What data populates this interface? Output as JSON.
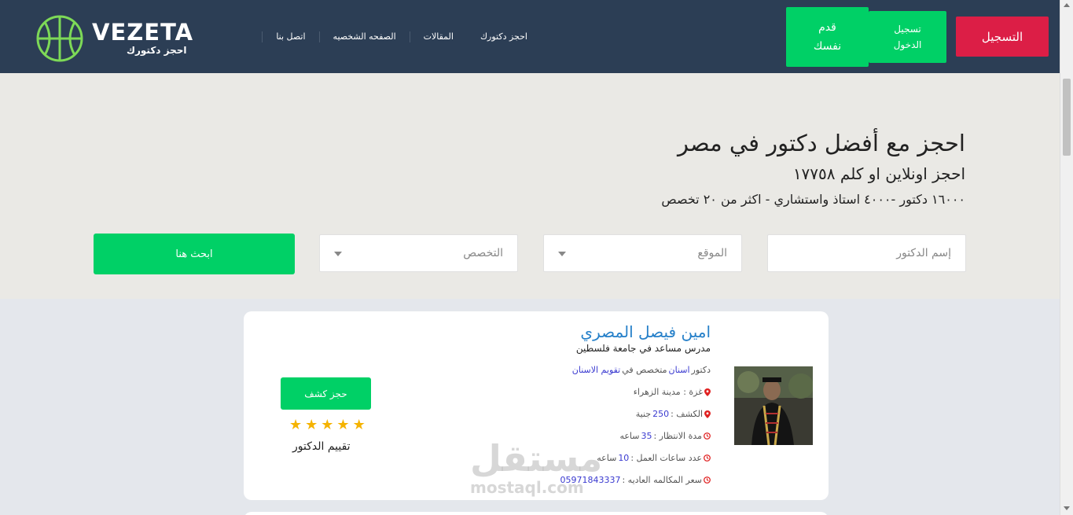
{
  "brand": {
    "name": "VEZETA",
    "tagline": "احجز دكتورك",
    "accent": "#00d066",
    "danger": "#dc1e46",
    "header_bg": "#2c3e55"
  },
  "header": {
    "register_label": "التسجيل",
    "login_label": "تسجيل الدخول",
    "apply_label": "قدم نفسك",
    "nav": [
      "اتصل بنا",
      "الصفحه الشخصيه",
      "المقالات",
      "احجز دكتورك"
    ]
  },
  "hero": {
    "title": "احجز مع أفضل دكتور في مصر",
    "subtitle": "احجز اونلاين او كلم ١٧٧٥٨",
    "stats": "١٦٠٠٠ دكتور -٤٠٠٠ استاذ واستشاري - اكثر من ٢٠ تخصص",
    "search": {
      "name_placeholder": "إسم الدكتور",
      "location_label": "الموقع",
      "specialty_label": "التخصص",
      "button_label": "ابحث هنا"
    }
  },
  "doctor": {
    "name": "امين فيصل المصري",
    "title": "مدرس مساعد في جامعة فلسطين",
    "specialty_prefix": "دكتور",
    "specialty": "اسنان",
    "specialty_mid": "متخصص في",
    "subspecialty": "تقويم الاسنان",
    "location": "غزة : مدينة الزهراء",
    "fee_label": "الكشف :",
    "fee_value": "250",
    "fee_unit": "جنية",
    "wait_label": "مدة الانتظار :",
    "wait_value": "35",
    "wait_unit": "ساعه",
    "hours_label": "عدد ساعات العمل :",
    "hours_value": "10",
    "hours_unit": "ساعه",
    "call_label": "سعر المكالمه العاديه :",
    "call_value": "05971843337",
    "book_label": "حجز كشف",
    "rating_label": "تقييم الدكتور",
    "rating": 5,
    "rating_max": 5
  },
  "watermark": {
    "ar": "مستقل",
    "en": "mostaql.com"
  }
}
